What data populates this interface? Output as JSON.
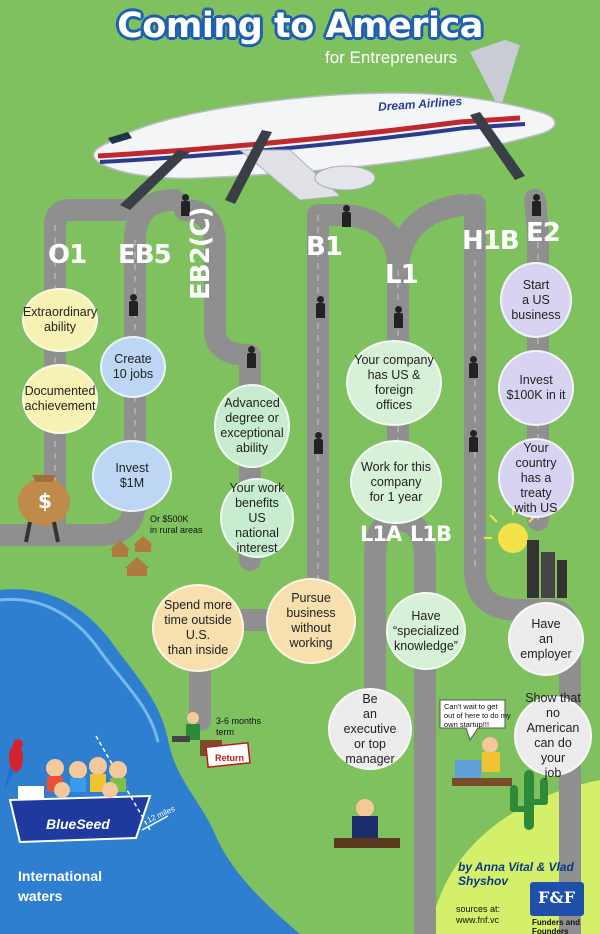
{
  "title": "Coming to America",
  "subtitle": "for Entrepreneurs",
  "airline": "Dream Airlines",
  "visa_labels": {
    "o1": "O1",
    "eb5": "EB5",
    "eb2c": "EB2(C)",
    "b1": "B1",
    "l1": "L1",
    "h1b": "H1B",
    "e2": "E2",
    "l1a": "L1A",
    "l1b": "L1B"
  },
  "bubbles": {
    "extraordinary": "Extraordinary\nability",
    "documented": "Documented\nachievement",
    "create_jobs": "Create\n10 jobs",
    "invest_1m": "Invest\n$1M",
    "advanced_degree": "Advanced\ndegree or\nexceptional\nability",
    "benefits_us": "Your work\nbenefits US\nnational\ninterest",
    "company_us_foreign": "Your company\nhas US & foreign\noffices",
    "work_for_company": "Work for this\ncompany\nfor 1 year",
    "start_us_business": "Start\na US\nbusiness",
    "invest_100k": "Invest\n$100K in it",
    "treaty": "Your country\nhas a treaty\nwith US",
    "spend_more_time": "Spend more\ntime outside U.S.\nthan inside",
    "pursue_business": "Pursue  business\nwithout working",
    "specialized": "Have\n“specialized\nknowledge”",
    "have_employer": "Have\nan employer",
    "executive": "Be\nan executive\nor top manager",
    "no_american": "Show that\nno American\ncan do your\njob"
  },
  "notes": {
    "rural": "Or $500K\nin rural areas",
    "term": "3-6 months\nterm",
    "startup": "Can't wait to get\nout of here to do my\nown startup!!!",
    "return_ticket": "Return"
  },
  "blueseed": "BlueSeed",
  "miles": "12 miles",
  "international_waters": "International\nwaters",
  "byline": "by  Anna Vital & Vlad Shyshov",
  "sources": "sources at:\nwww.fnf.vc",
  "ff_logo": "F&F",
  "ff_name": "Funders and Founders",
  "colors": {
    "background": "#7fc15f",
    "road": "#8f8f8f",
    "water": "#2f7fd0",
    "title_outline": "#1f5fb3"
  }
}
